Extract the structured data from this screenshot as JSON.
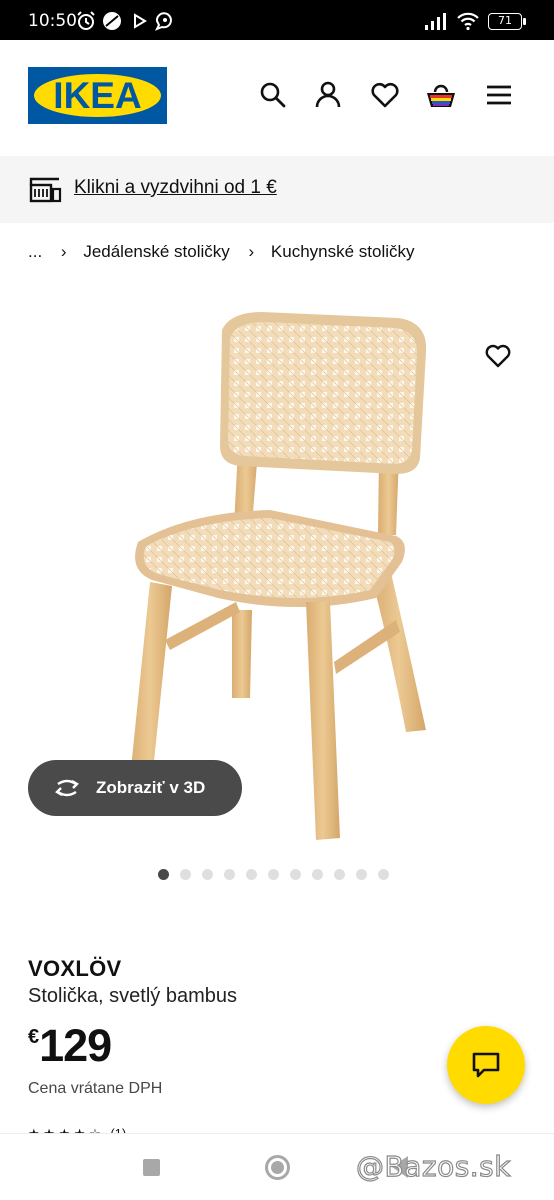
{
  "status_bar": {
    "time": "10:50",
    "battery": "71",
    "icons": [
      "alarm-icon",
      "moon-icon",
      "play-icon",
      "chat-bubble-icon",
      "signal-icon",
      "wifi-icon",
      "battery-icon"
    ]
  },
  "header": {
    "logo_text": "IKEA",
    "icons": [
      "search-icon",
      "account-icon",
      "heart-icon",
      "basket-icon",
      "menu-icon"
    ]
  },
  "promo": {
    "icon": "store-pickup-icon",
    "text": "Klikni a vyzdvihni od 1 €"
  },
  "breadcrumb": {
    "ellipsis": "...",
    "items": [
      "Jedálenské stoličky",
      "Kuchynské stoličky"
    ]
  },
  "gallery": {
    "favourite_icon": "heart-icon",
    "view_3d_label": "Zobraziť v 3D",
    "image_count": 11,
    "active_index": 0
  },
  "product": {
    "name": "VOXLÖV",
    "description": "Stolička, svetlý bambus",
    "currency": "€",
    "price": "129",
    "vat_note": "Cena vrátane DPH",
    "review_count": "(1)"
  },
  "chat": {
    "icon": "chat-icon"
  },
  "watermark": "@Bazos.sk",
  "colors": {
    "ikea_blue": "#0058a3",
    "ikea_yellow": "#ffdb00",
    "pill_bg": "#4a4a4a",
    "promo_bg": "#f5f5f5"
  }
}
